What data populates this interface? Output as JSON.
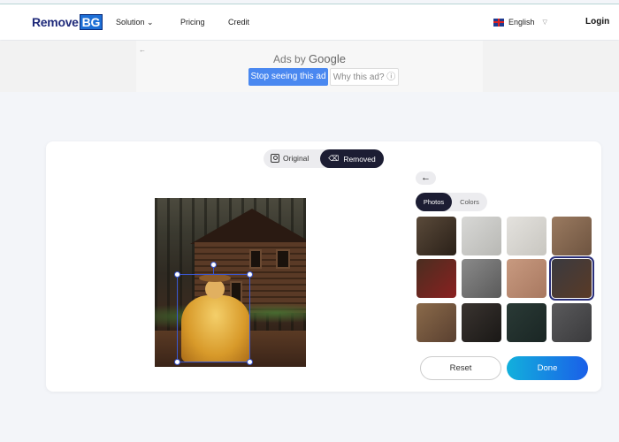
{
  "header": {
    "logo_text": "Remove",
    "logo_badge": "BG",
    "nav": [
      {
        "label": "Solution"
      },
      {
        "label": "Pricing"
      },
      {
        "label": "Credit"
      }
    ],
    "language": "English",
    "login": "Login"
  },
  "ad": {
    "ads_by": "Ads by",
    "google": "Google",
    "stop_label": "Stop seeing this ad",
    "why_label": "Why this ad?"
  },
  "editor": {
    "toggle": {
      "original": "Original",
      "removed": "Removed",
      "active": "Removed"
    },
    "background_tabs": {
      "photos": "Photos",
      "colors": "Colors",
      "active": "Photos"
    },
    "thumbnails": [
      {
        "colors": [
          "#5a4a3a",
          "#2a2018"
        ],
        "selected": false
      },
      {
        "colors": [
          "#d8d8d6",
          "#b8b8b4"
        ],
        "selected": false
      },
      {
        "colors": [
          "#e4e2de",
          "#c8c6c0"
        ],
        "selected": false
      },
      {
        "colors": [
          "#9a7a60",
          "#6e5440"
        ],
        "selected": false
      },
      {
        "colors": [
          "#4a2e20",
          "#8a2020"
        ],
        "selected": false
      },
      {
        "colors": [
          "#8a8a8a",
          "#5a5a5a"
        ],
        "selected": false
      },
      {
        "colors": [
          "#c89a80",
          "#a87860"
        ],
        "selected": false
      },
      {
        "colors": [
          "#3a3a40",
          "#5a3a26"
        ],
        "selected": true
      },
      {
        "colors": [
          "#8a6a4a",
          "#5a4030"
        ],
        "selected": false
      },
      {
        "colors": [
          "#3a3430",
          "#1a1816"
        ],
        "selected": false
      },
      {
        "colors": [
          "#2a3a36",
          "#1a2624"
        ],
        "selected": false
      },
      {
        "colors": [
          "#5a5a5c",
          "#3a3a3c"
        ],
        "selected": false
      }
    ],
    "reset_label": "Reset",
    "done_label": "Done"
  }
}
